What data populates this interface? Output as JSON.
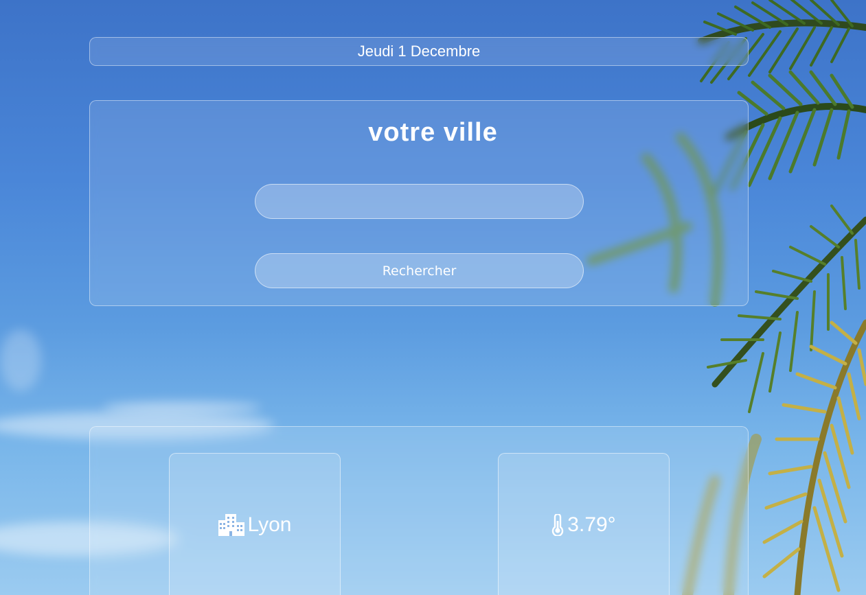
{
  "header": {
    "date": "Jeudi 1 Decembre"
  },
  "search": {
    "title": "votre ville",
    "input_value": "",
    "button_label": "Rechercher"
  },
  "results": {
    "city": {
      "icon": "building-icon",
      "value": "Lyon"
    },
    "temperature": {
      "icon": "thermometer-icon",
      "value": "3.79°"
    }
  },
  "colors": {
    "sky_top": "#3d73c8",
    "sky_bottom": "#9bcbf0",
    "text": "#ffffff"
  }
}
